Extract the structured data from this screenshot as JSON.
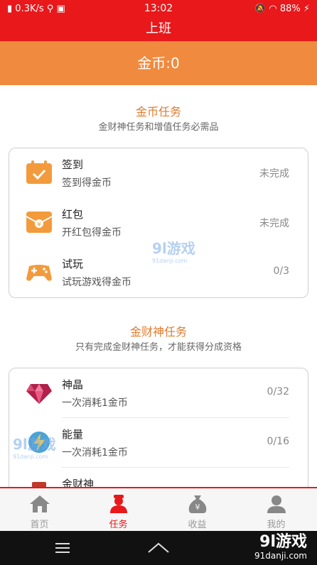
{
  "status_bar": {
    "speed": "0.3K/s",
    "time": "13:02",
    "battery": "88%"
  },
  "title": "上班",
  "coin_banner": "金币:0",
  "coin_tasks": {
    "title": "金币任务",
    "subtitle": "金财神任务和增值任务必需品",
    "items": [
      {
        "name": "签到",
        "desc": "签到得金币",
        "status": "未完成",
        "icon": "calendar-check-icon"
      },
      {
        "name": "红包",
        "desc": "开红包得金币",
        "status": "未完成",
        "icon": "red-envelope-icon"
      },
      {
        "name": "试玩",
        "desc": "试玩游戏得金币",
        "status": "0/3",
        "icon": "gamepad-icon"
      }
    ]
  },
  "god_tasks": {
    "title": "金财神任务",
    "subtitle": "只有完成金财神任务，才能获得分成资格",
    "items": [
      {
        "name": "神晶",
        "desc": "一次消耗1金币",
        "status": "0/32",
        "icon": "gem-icon"
      },
      {
        "name": "能量",
        "desc": "一次消耗1金币",
        "status": "0/16",
        "icon": "energy-icon"
      },
      {
        "name": "金财神",
        "icon": "fortune-god-icon"
      }
    ]
  },
  "watermark": {
    "brand": "9l游戏",
    "url": "91danji.com"
  },
  "tabs": [
    {
      "label": "首页",
      "icon": "home-icon",
      "active": false
    },
    {
      "label": "任务",
      "icon": "task-person-icon",
      "active": true
    },
    {
      "label": "收益",
      "icon": "money-bag-icon",
      "active": false
    },
    {
      "label": "我的",
      "icon": "profile-icon",
      "active": false
    }
  ],
  "colors": {
    "header_red": "#e8181b",
    "banner_orange": "#f08a3e",
    "section_title": "#e07b2e",
    "icon_orange": "#f39b3c"
  }
}
